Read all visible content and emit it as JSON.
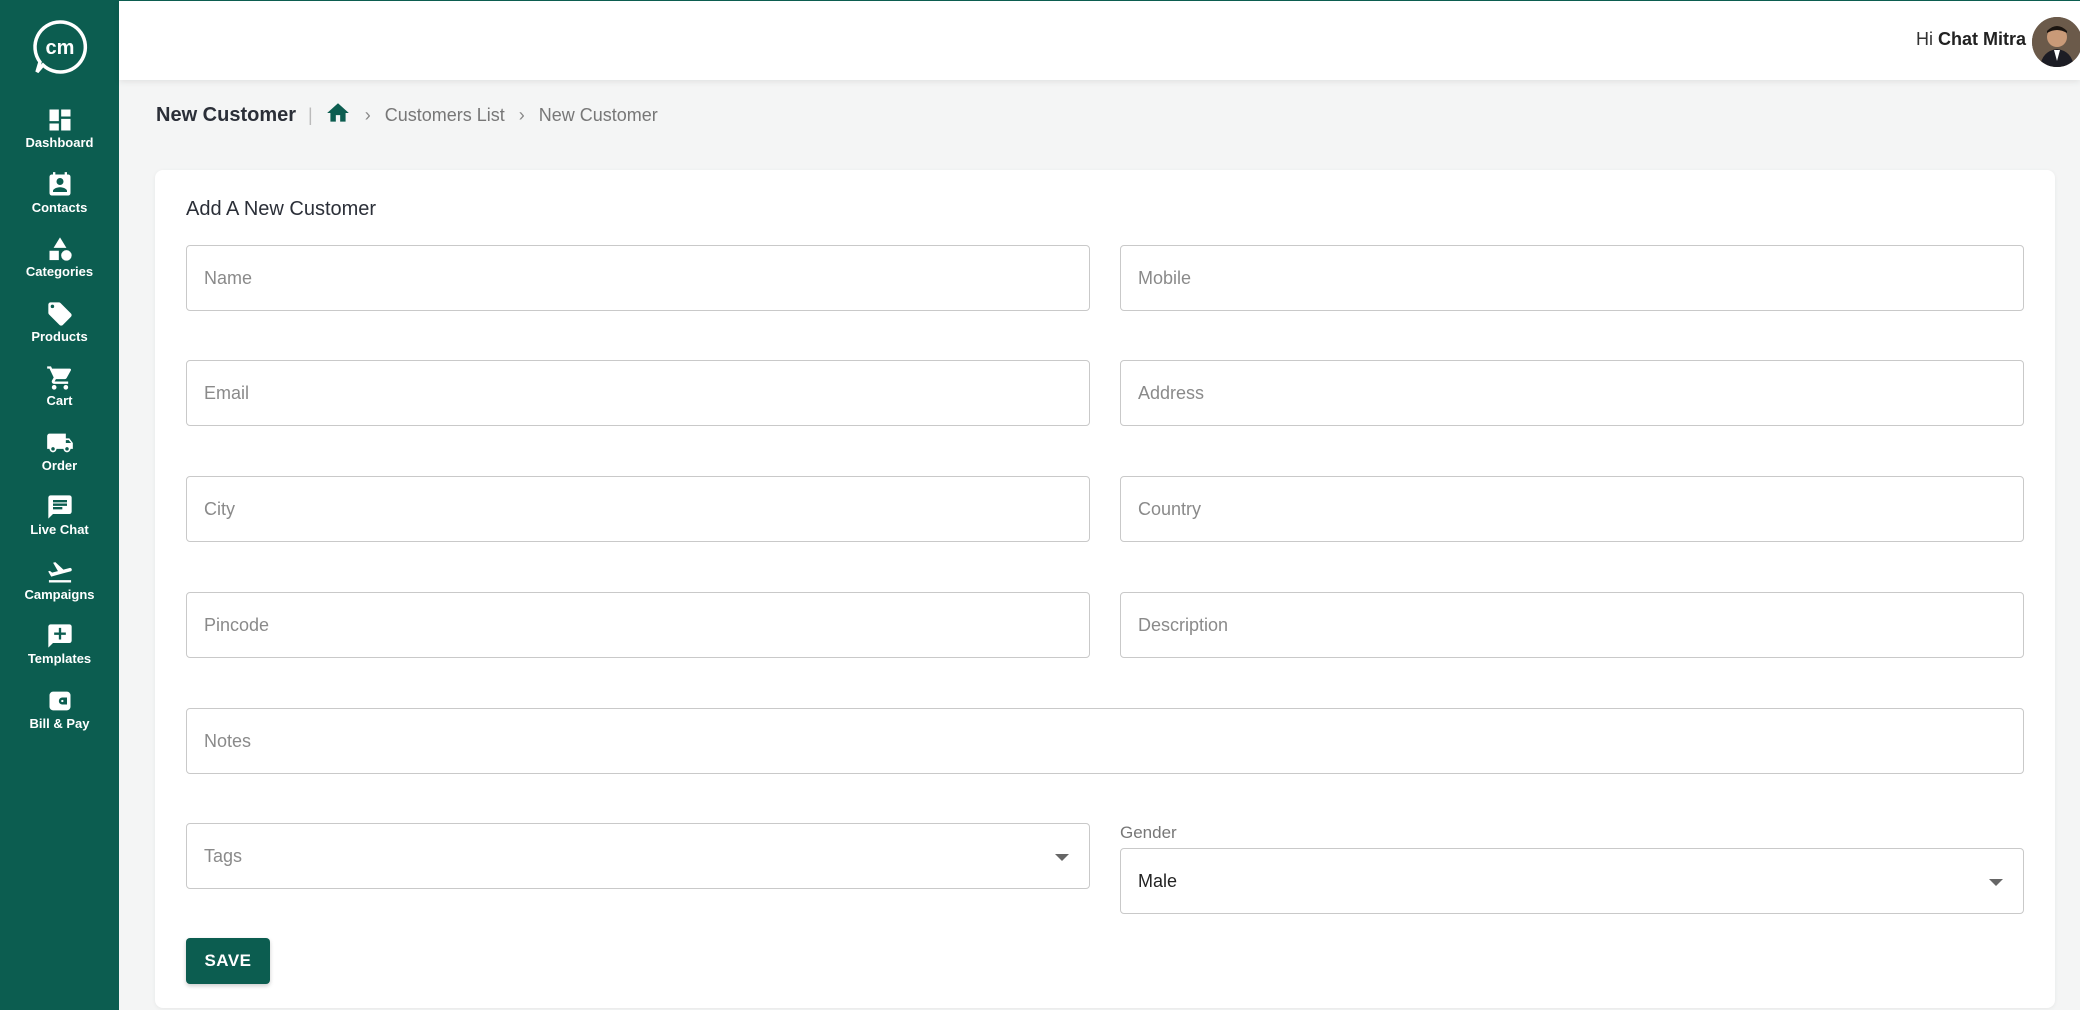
{
  "brand": {
    "accent": "#0c5d50",
    "logo_text": "cm"
  },
  "sidebar": {
    "items": [
      {
        "label": "Dashboard",
        "icon": "dashboard-icon"
      },
      {
        "label": "Contacts",
        "icon": "contacts-icon"
      },
      {
        "label": "Categories",
        "icon": "categories-icon"
      },
      {
        "label": "Products",
        "icon": "tag-icon"
      },
      {
        "label": "Cart",
        "icon": "cart-icon"
      },
      {
        "label": "Order",
        "icon": "truck-icon"
      },
      {
        "label": "Live Chat",
        "icon": "chat-icon"
      },
      {
        "label": "Campaigns",
        "icon": "plane-icon"
      },
      {
        "label": "Templates",
        "icon": "template-icon"
      },
      {
        "label": "Bill & Pay",
        "icon": "wallet-icon"
      }
    ]
  },
  "header": {
    "greeting": "Hi",
    "user_name": "Chat Mitra"
  },
  "breadcrumb": {
    "title": "New Customer",
    "sep": "|",
    "items": [
      "Customers List",
      "New Customer"
    ]
  },
  "form": {
    "title": "Add A New Customer",
    "name_placeholder": "Name",
    "mobile_placeholder": "Mobile",
    "email_placeholder": "Email",
    "address_placeholder": "Address",
    "city_placeholder": "City",
    "country_placeholder": "Country",
    "pincode_placeholder": "Pincode",
    "description_placeholder": "Description",
    "notes_placeholder": "Notes",
    "tags_placeholder": "Tags",
    "gender_label": "Gender",
    "gender_value": "Male",
    "save_label": "SAVE"
  }
}
